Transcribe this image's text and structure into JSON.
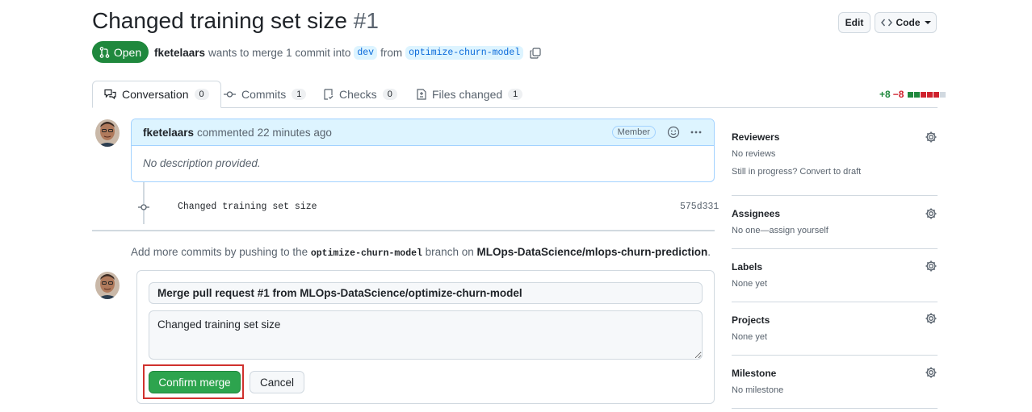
{
  "pr": {
    "title": "Changed training set size",
    "number": "#1",
    "status": "Open",
    "author": "fketelaars",
    "merge_text": "wants to merge 1 commit into",
    "base_branch": "dev",
    "from_text": "from",
    "head_branch": "optimize-churn-model"
  },
  "header_buttons": {
    "edit": "Edit",
    "code": "Code"
  },
  "tabs": [
    {
      "label": "Conversation",
      "count": "0"
    },
    {
      "label": "Commits",
      "count": "1"
    },
    {
      "label": "Checks",
      "count": "0"
    },
    {
      "label": "Files changed",
      "count": "1"
    }
  ],
  "diffstat": {
    "additions": "+8",
    "deletions": "−8",
    "colors": [
      "#1f883d",
      "#1f883d",
      "#cf222e",
      "#cf222e",
      "#cf222e",
      "#d1d9e0"
    ]
  },
  "comment": {
    "author": "fketelaars",
    "action": "commented",
    "time": "22 minutes ago",
    "role": "Member",
    "body": "No description provided."
  },
  "commit": {
    "message": "Changed training set size",
    "sha": "575d331"
  },
  "push_info": {
    "prefix": "Add more commits by pushing to the",
    "branch": "optimize-churn-model",
    "middle": "branch on",
    "repo": "MLOps-DataScience/mlops-churn-prediction",
    "suffix": "."
  },
  "merge": {
    "title_value": "Merge pull request #1 from MLOps-DataScience/optimize-churn-model",
    "description_value": "Changed training set size",
    "confirm_label": "Confirm merge",
    "cancel_label": "Cancel"
  },
  "sidebar": {
    "reviewers": {
      "title": "Reviewers",
      "line1": "No reviews",
      "line2": "Still in progress? Convert to draft"
    },
    "assignees": {
      "title": "Assignees",
      "value": "No one—assign yourself"
    },
    "labels": {
      "title": "Labels",
      "value": "None yet"
    },
    "projects": {
      "title": "Projects",
      "value": "None yet"
    },
    "milestone": {
      "title": "Milestone",
      "value": "No milestone"
    }
  },
  "colors": {
    "accent_green": "#1f883d",
    "link_blue": "#0969da",
    "highlight_red": "#d0312d"
  }
}
